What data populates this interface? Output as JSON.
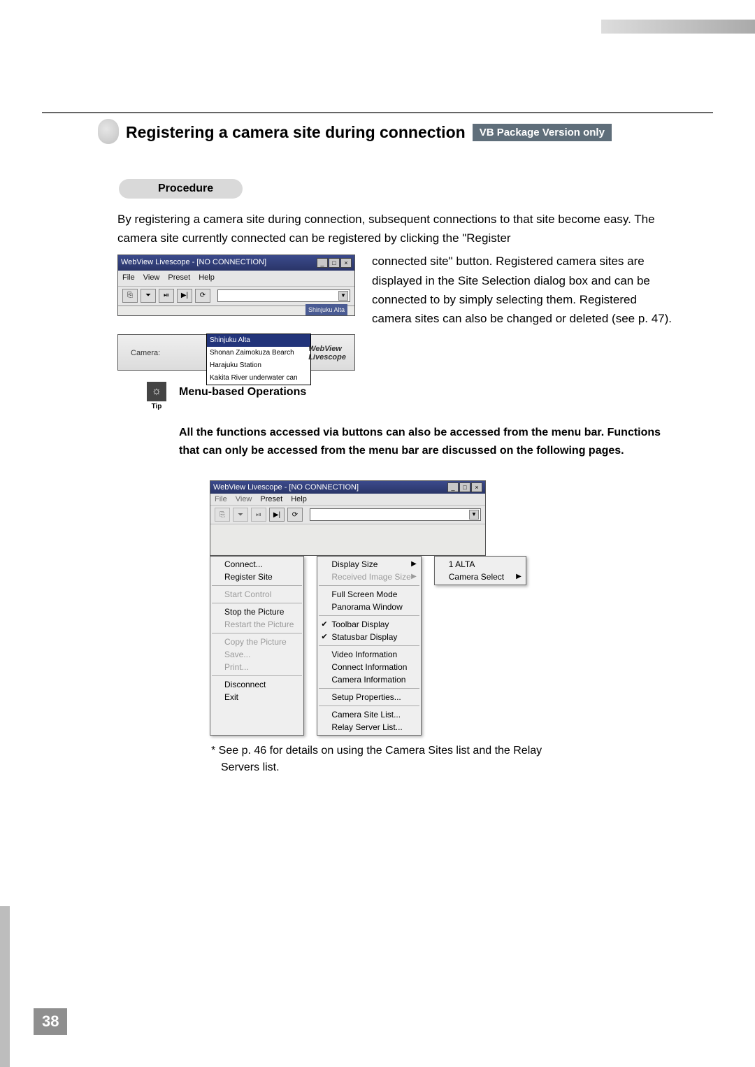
{
  "header": {
    "title": "Registering a camera site during connection",
    "badge": "VB Package Version only"
  },
  "procedure_label": "Procedure",
  "intro_text": "By registering a camera site during connection, subsequent connections to that site become easy. The camera site currently connected can be registered by clicking the \"Register",
  "right_paragraph": "connected site\" button. Registered camera sites are displayed in the Site Selection dialog box and can be connected to by simply selecting them. Registered camera sites can also be changed or deleted (see p. 47).",
  "screenshot1": {
    "window_title": "WebView Livescope -  [NO CONNECTION]",
    "menus": [
      "File",
      "View",
      "Preset",
      "Help"
    ],
    "toolbar_buttons": [
      "⎘",
      "⏷",
      "⏯",
      "▶|",
      "⟳"
    ],
    "tooltip": "Shinjuku Alta"
  },
  "screenshot2": {
    "camera_label": "Camera:",
    "options": [
      "Shinjuku Alta",
      "Shonan Zaimokuza Bearch",
      "Harajuku Station",
      "Kakita River underwater can"
    ],
    "logo_line1": "WebView",
    "logo_line2": "Livescope"
  },
  "tip": {
    "label": "Tip",
    "title": "Menu-based Operations",
    "paragraph": "All the functions accessed via buttons can also be accessed from the menu bar. Functions that can only be accessed from the menu bar are discussed on the following pages."
  },
  "screenshot3": {
    "window_title": "WebView Livescope -  [NO CONNECTION]",
    "menus": [
      "File",
      "View",
      "Preset",
      "Help"
    ]
  },
  "menu_file": [
    {
      "label": "Connect...",
      "disabled": false
    },
    {
      "label": "Register Site",
      "disabled": false
    },
    {
      "sep": true
    },
    {
      "label": "Start Control",
      "disabled": true
    },
    {
      "sep": true
    },
    {
      "label": "Stop the Picture",
      "disabled": false
    },
    {
      "label": "Restart the Picture",
      "disabled": true
    },
    {
      "sep": true
    },
    {
      "label": "Copy the Picture",
      "disabled": true
    },
    {
      "label": "Save...",
      "disabled": true
    },
    {
      "label": "Print...",
      "disabled": true
    },
    {
      "sep": true
    },
    {
      "label": "Disconnect",
      "disabled": false
    },
    {
      "label": "Exit",
      "disabled": false
    }
  ],
  "menu_view": [
    {
      "label": "Display Size",
      "submenu": true
    },
    {
      "label": "Received Image Size",
      "submenu": true,
      "disabled": true
    },
    {
      "sep": true
    },
    {
      "label": "Full Screen Mode"
    },
    {
      "label": "Panorama Window"
    },
    {
      "sep": true
    },
    {
      "label": "Toolbar Display",
      "checked": true
    },
    {
      "label": "Statusbar Display",
      "checked": true
    },
    {
      "sep": true
    },
    {
      "label": "Video Information"
    },
    {
      "label": "Connect Information"
    },
    {
      "label": "Camera Information"
    },
    {
      "sep": true
    },
    {
      "label": "Setup Properties..."
    },
    {
      "sep": true
    },
    {
      "label": "Camera Site List..."
    },
    {
      "label": "Relay Server List..."
    }
  ],
  "menu_preset": [
    {
      "label": "1 ALTA"
    },
    {
      "label": "Camera Select",
      "submenu": true
    }
  ],
  "footnote_line1": "* See p. 46 for details on using the Camera Sites list and the Relay",
  "footnote_line2": "Servers list.",
  "page_number": "38"
}
